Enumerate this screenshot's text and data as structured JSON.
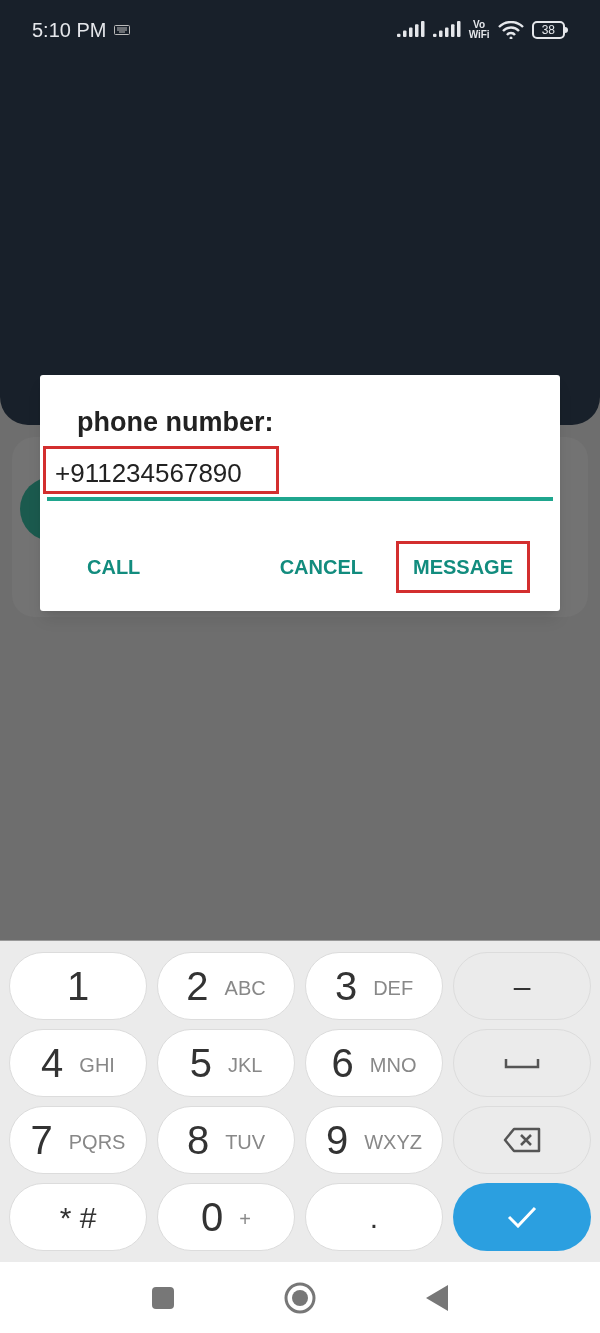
{
  "status_bar": {
    "time": "5:10 PM",
    "vo": "Vo",
    "wifi": "WiFi",
    "battery": "38"
  },
  "dialog": {
    "title": "phone number:",
    "value": "+911234567890",
    "buttons": [
      {
        "label": "CALL",
        "highlighted": false
      },
      {
        "label": "CANCEL",
        "highlighted": false
      },
      {
        "label": "MESSAGE",
        "highlighted": true
      }
    ],
    "field_highlighted": true
  },
  "keypad": [
    {
      "kind": "digit",
      "label": "1"
    },
    {
      "kind": "digit",
      "label": "2",
      "letters": "ABC"
    },
    {
      "kind": "digit",
      "label": "3",
      "letters": "DEF"
    },
    {
      "kind": "function",
      "label": "–"
    },
    {
      "kind": "digit",
      "label": "4",
      "letters": "GHI"
    },
    {
      "kind": "digit",
      "label": "5",
      "letters": "JKL"
    },
    {
      "kind": "digit",
      "label": "6",
      "letters": "MNO"
    },
    {
      "kind": "space"
    },
    {
      "kind": "digit",
      "label": "7",
      "letters": "PQRS"
    },
    {
      "kind": "digit",
      "label": "8",
      "letters": "TUV"
    },
    {
      "kind": "digit",
      "label": "9",
      "letters": "WXYZ"
    },
    {
      "kind": "backspace"
    },
    {
      "kind": "symbol",
      "label": "* #"
    },
    {
      "kind": "digit",
      "label": "0",
      "letters": "+"
    },
    {
      "kind": "symbol",
      "label": "."
    },
    {
      "kind": "confirm"
    }
  ]
}
